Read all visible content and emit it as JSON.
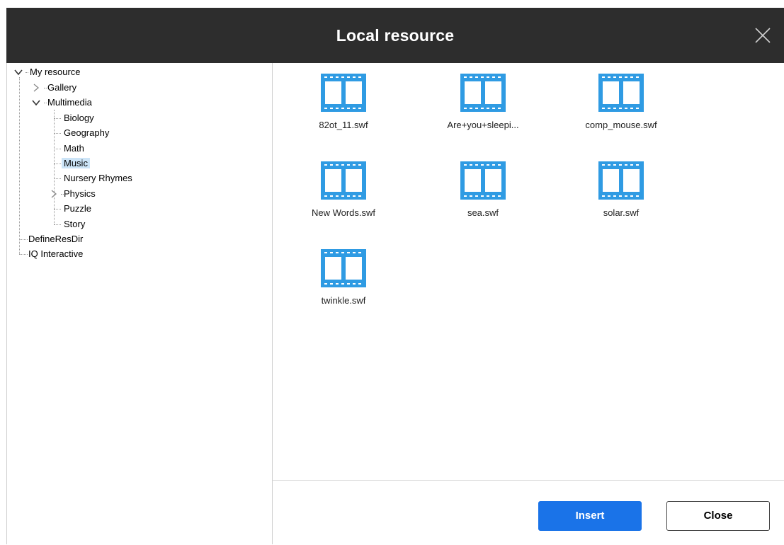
{
  "window": {
    "title": "Local resource"
  },
  "tree": {
    "root": "My resource",
    "gallery": "Gallery",
    "multimedia": "Multimedia",
    "multimedia_children": [
      "Biology",
      "Geography",
      "Math",
      "Music",
      "Nursery Rhymes",
      "Physics",
      "Puzzle",
      "Story"
    ],
    "selected": "Music",
    "define_res_dir": "DefineResDir",
    "iq_interactive": "IQ Interactive"
  },
  "files": [
    {
      "name": "82ot_11.swf",
      "icon": "film-icon"
    },
    {
      "name": "Are+you+sleepi...",
      "icon": "film-icon"
    },
    {
      "name": "comp_mouse.swf",
      "icon": "film-icon"
    },
    {
      "name": "New Words.swf",
      "icon": "film-icon"
    },
    {
      "name": "sea.swf",
      "icon": "film-icon"
    },
    {
      "name": "solar.swf",
      "icon": "film-icon"
    },
    {
      "name": "twinkle.swf",
      "icon": "film-icon"
    }
  ],
  "buttons": {
    "insert": "Insert",
    "close": "Close"
  },
  "colors": {
    "titlebar": "#2d2d2d",
    "accent": "#1a73e8",
    "film_icon": "#2f9be3",
    "selection": "#cce4f7"
  }
}
